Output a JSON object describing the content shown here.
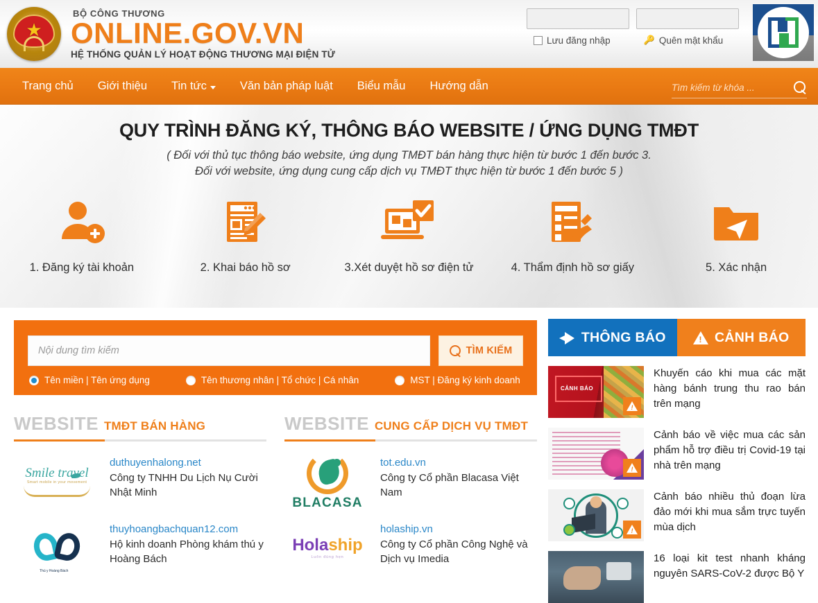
{
  "header": {
    "ministry": "BỘ CÔNG THƯƠNG",
    "site_name": "ONLINE.GOV.VN",
    "tagline": "HỆ THỐNG QUẢN LÝ HOẠT ĐỘNG THƯƠNG MẠI ĐIỆN TỬ",
    "login": {
      "username_value": "",
      "password_value": "",
      "remember_label": "Lưu đăng nhập",
      "forgot_label": "Quên mật khẩu"
    }
  },
  "nav": {
    "items": [
      {
        "label": "Trang chủ",
        "has_caret": false
      },
      {
        "label": "Giới thiệu",
        "has_caret": false
      },
      {
        "label": "Tin tức",
        "has_caret": true
      },
      {
        "label": "Văn bản pháp luật",
        "has_caret": false
      },
      {
        "label": "Biểu mẫu",
        "has_caret": false
      },
      {
        "label": "Hướng dẫn",
        "has_caret": false
      }
    ],
    "search_placeholder": "Tìm kiếm từ khóa ...",
    "search_value": ""
  },
  "hero": {
    "title": "QUY TRÌNH ĐĂNG KÝ, THÔNG BÁO WEBSITE / ỨNG DỤNG TMĐT",
    "subtitle_line1": "( Đối với thủ tục thông báo website, ứng dụng TMĐT bán hàng thực hiện từ bước 1 đến bước 3.",
    "subtitle_line2": "Đối với website, ứng dụng cung cấp dịch vụ TMĐT thực hiện từ bước 1 đến bước 5 )",
    "steps": [
      {
        "label": "1. Đăng ký tài khoản",
        "icon": "user-add-icon"
      },
      {
        "label": "2. Khai báo hồ sơ",
        "icon": "document-edit-icon"
      },
      {
        "label": "3.Xét duyệt hồ sơ điện tử",
        "icon": "laptop-check-icon"
      },
      {
        "label": "4. Thẩm định hồ sơ giấy",
        "icon": "checklist-sign-icon"
      },
      {
        "label": "5. Xác nhận",
        "icon": "folder-send-icon"
      }
    ]
  },
  "search_panel": {
    "placeholder": "Nội dung tìm kiếm",
    "value": "",
    "button_label": "TÌM KIẾM",
    "options": [
      {
        "label": "Tên miền | Tên ứng dụng",
        "selected": true
      },
      {
        "label": "Tên thương nhân | Tổ chức | Cá nhân",
        "selected": false
      },
      {
        "label": "MST | Đăng ký kinh doanh",
        "selected": false
      }
    ]
  },
  "website_sections": [
    {
      "title_main": "WEBSITE",
      "title_accent": "TMĐT BÁN HÀNG",
      "entries": [
        {
          "domain": "duthuyenhalong.net",
          "company": "Công ty TNHH Du Lịch Nụ Cười Nhật Minh",
          "logo": "smile-travel-logo"
        },
        {
          "domain": "thuyhoangbachquan12.com",
          "company": "Hộ kinh doanh Phòng khám thú y Hoàng Bách",
          "logo": "thu-y-hoang-bach-logo"
        }
      ]
    },
    {
      "title_main": "WEBSITE",
      "title_accent": "CUNG CẤP DỊCH VỤ TMĐT",
      "entries": [
        {
          "domain": "tot.edu.vn",
          "company": "Công ty Cổ phần Blacasa Việt Nam",
          "logo": "blacasa-logo"
        },
        {
          "domain": "holaship.vn",
          "company": "Công ty Cổ phần Công Nghệ và Dịch vụ Imedia",
          "logo": "holaship-logo"
        }
      ]
    }
  ],
  "sidebar": {
    "tabs": [
      {
        "label": "THÔNG BÁO",
        "icon": "megaphone-icon",
        "active": true
      },
      {
        "label": "CẢNH BÁO",
        "icon": "warning-triangle-icon",
        "active": false
      }
    ],
    "news": [
      {
        "title": "Khuyến cáo khi mua các mặt hàng bánh trung thu rao bán trên mạng",
        "thumb_caption": "CẢNH BÁO"
      },
      {
        "title": "Cảnh báo về việc mua các sản phẩm hỗ trợ điều trị Covid-19 tại nhà trên mạng",
        "thumb_caption": ""
      },
      {
        "title": "Cảnh báo nhiều thủ đoạn lừa đảo mới khi mua sắm trực tuyến mùa dịch",
        "thumb_caption": ""
      },
      {
        "title": "16 loại kit test nhanh kháng nguyên SARS-CoV-2 được Bộ Y",
        "thumb_caption": ""
      }
    ]
  },
  "colors": {
    "orange": "#ef7f1a",
    "orange_dark": "#f2700f",
    "blue": "#1271bd",
    "link_blue": "#2a87c8",
    "gray_title": "#c9c9c9"
  }
}
